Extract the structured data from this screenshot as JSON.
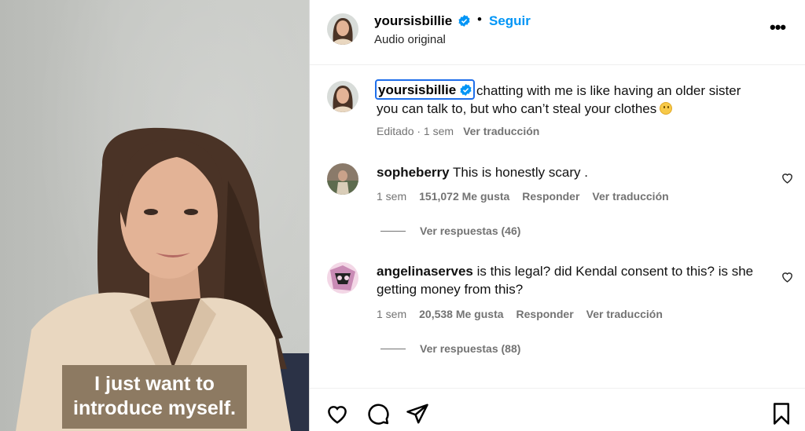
{
  "video": {
    "caption_lines": [
      "I just want to",
      "introduce myself."
    ]
  },
  "header": {
    "username": "yoursisbillie",
    "separator": "•",
    "follow_label": "Seguir",
    "subtitle": "Audio original",
    "more_label": "•••"
  },
  "post_caption": {
    "username": "yoursisbillie",
    "text_line1": "chatting with me is like having an older sister",
    "text_line2": "you can talk to, but who can’t steal your clothes",
    "edited": "Editado · 1 sem",
    "translate": "Ver traducción"
  },
  "comments": [
    {
      "username": "sopheberry",
      "text": "This is honestly scary .",
      "age": "1 sem",
      "likes": "151,072 Me gusta",
      "reply": "Responder",
      "translate": "Ver traducción",
      "view_replies": "Ver respuestas (46)"
    },
    {
      "username": "angelinaserves",
      "text": "is this legal? did Kendal consent to this? is she getting money from this?",
      "age": "1 sem",
      "likes": "20,538 Me gusta",
      "reply": "Responder",
      "translate": "Ver traducción",
      "view_replies": "Ver respuestas (88)"
    }
  ],
  "colors": {
    "accent_blue": "#0095f6",
    "verified_blue": "#0095f6",
    "caption_box": "#8d7a62",
    "muted_text": "#737373"
  },
  "icons": [
    "verified-badge-icon",
    "more-options-icon",
    "heart-icon",
    "comment-icon",
    "share-icon",
    "bookmark-icon"
  ]
}
